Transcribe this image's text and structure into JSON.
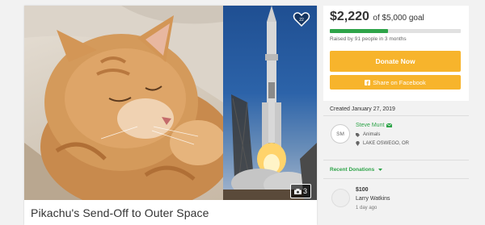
{
  "campaign": {
    "title": "Pikachu's Send-Off to Outer Space",
    "heart_count": "22",
    "photo_count": "3"
  },
  "funding": {
    "raised_amount": "$2,220",
    "goal_text": "of $5,000 goal",
    "progress_fraction": 0.444,
    "raised_by": "Raised by 91 people in 3 months"
  },
  "actions": {
    "donate_label": "Donate Now",
    "share_label": "Share on Facebook"
  },
  "created": "Created January 27, 2019",
  "organizer": {
    "initials": "SM",
    "name": "Steve Munt",
    "category": "Animals",
    "location": "LAKE OSWEGO, OR"
  },
  "donations": {
    "tab_label": "Recent Donations",
    "items": [
      {
        "amount": "$100",
        "name": "Larry Watkins",
        "time": "1 day ago"
      }
    ]
  },
  "colors": {
    "accent_green": "#2ea449",
    "donate_orange": "#f7b42c"
  },
  "icons": {
    "heart": "heart-icon",
    "camera": "camera-icon",
    "facebook": "facebook-icon",
    "email": "email-icon",
    "tag": "tag-icon",
    "location": "location-pin-icon",
    "chevron": "chevron-down-icon"
  }
}
